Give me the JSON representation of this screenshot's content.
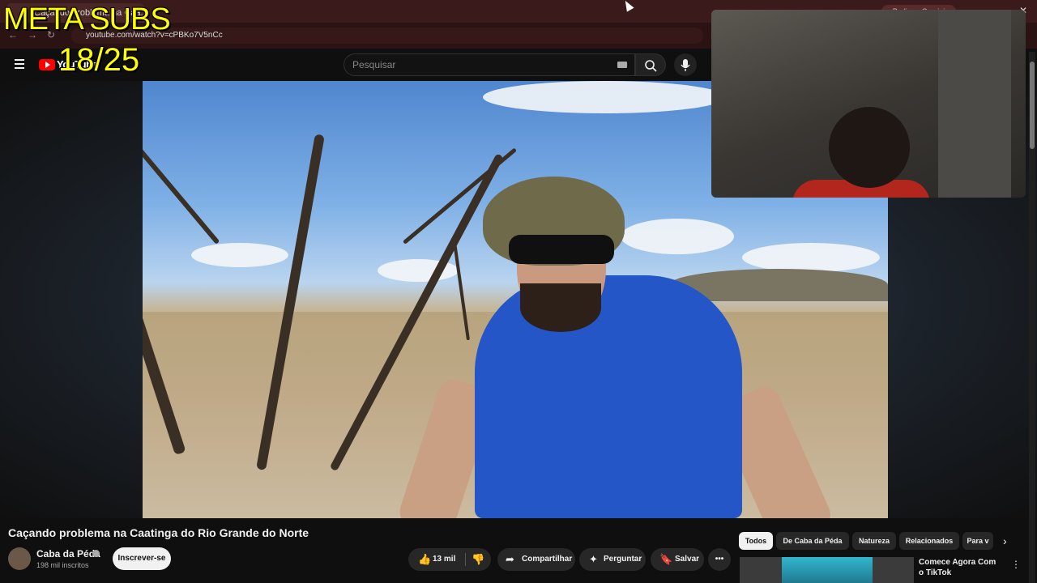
{
  "browser": {
    "tab_title": "Caçando problema na Caa...",
    "tab_close": "✕",
    "url": "youtube.com/watch?v=cPBKo7V5nCc",
    "profile_label": "Pedir ao Gemini"
  },
  "overlay": {
    "goal_text": "META SUBS",
    "goal_count": "18/25"
  },
  "youtube": {
    "logo_text": "YouTube",
    "search_placeholder": "Pesquisar"
  },
  "video": {
    "title": "Caçando problema na Caatinga do Rio Grande do Norte",
    "channel": "Caba da Péda",
    "subscribers": "198 mil inscritos",
    "subscribe_label": "Inscrever-se",
    "likes": "13 mil",
    "share_label": "Compartilhar",
    "ask_label": "Perguntar",
    "save_label": "Salvar",
    "more_label": "•••"
  },
  "chips": [
    "Todos",
    "De Caba da Péda",
    "Natureza",
    "Relacionados",
    "Para v"
  ],
  "recommended": {
    "title": "Comece Agora Com o TikTok"
  },
  "colors": {
    "background": "#0f0f0f",
    "overlay_text": "#ffff00",
    "brand_red": "#ff0000"
  }
}
